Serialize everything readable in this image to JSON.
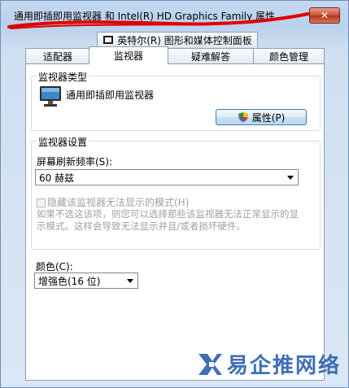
{
  "window": {
    "title": "通用即插即用监视器 和 Intel(R) HD Graphics Family 属性",
    "close_label": "✕",
    "annotation_color": "#e00000"
  },
  "tabs": {
    "top_row": [
      "英特尔(R) 图形和媒体控制面板"
    ],
    "bottom_row": [
      "适配器",
      "监视器",
      "疑难解答",
      "颜色管理"
    ],
    "active": "监视器"
  },
  "monitor_type": {
    "group_title": "监视器类型",
    "monitor_name": "通用即插即用监视器",
    "properties_button": "属性(P)",
    "icon": "monitor-icon"
  },
  "monitor_settings": {
    "group_title": "监视器设置",
    "refresh_label": "屏幕刷新频率(S):",
    "refresh_value": "60 赫兹",
    "hide_modes_label": "隐藏该监视器无法显示的模式(H)",
    "hide_modes_checked": false,
    "description": "如果不选这该项，则您可以选择那些该监视器无法正常显示的显示模式。这样会导致无法显示并且/或者损坏硬件。"
  },
  "color": {
    "label": "颜色(C):",
    "value": "增强色(16 位)"
  },
  "watermark": {
    "text": "易企推网络"
  }
}
